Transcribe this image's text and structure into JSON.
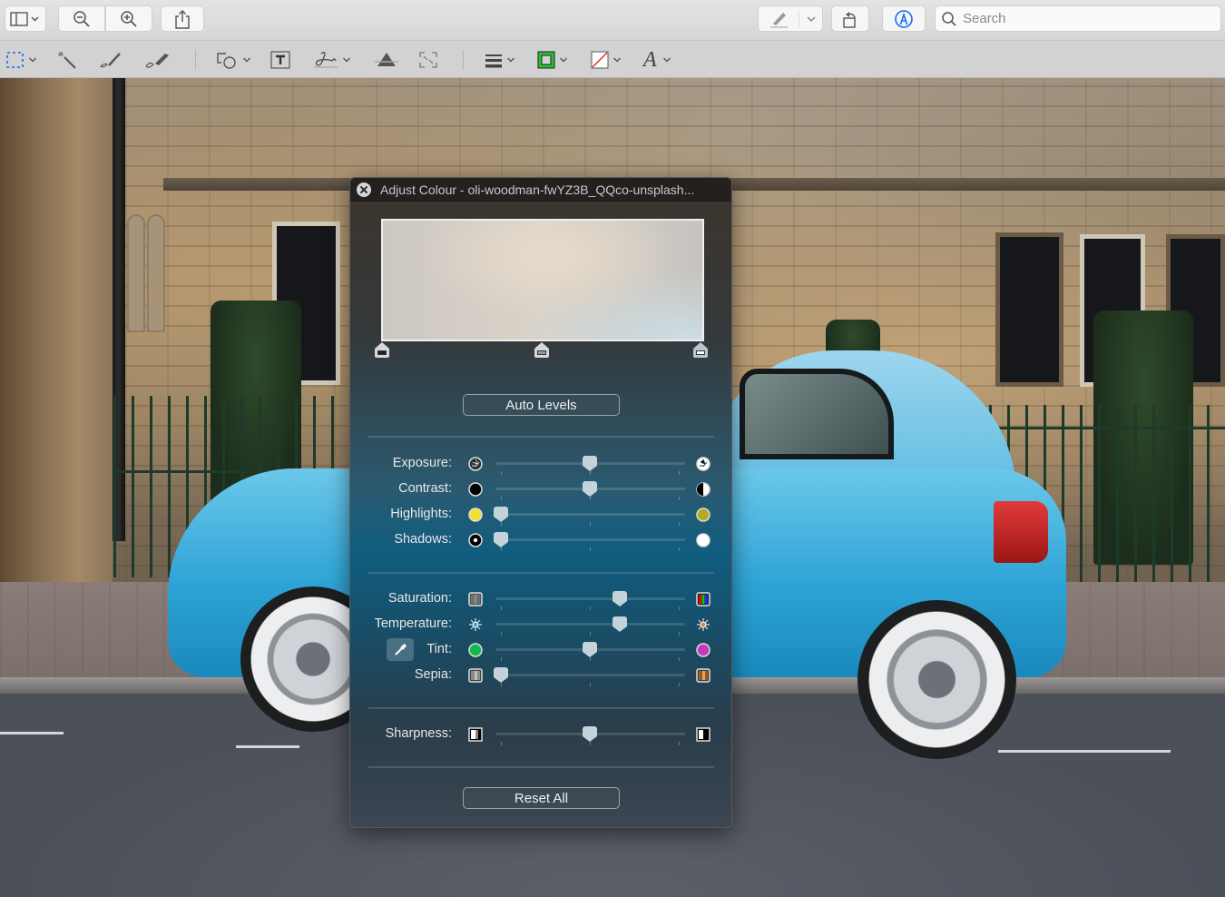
{
  "toolbar": {
    "sidebar_icon": "sidebar-icon",
    "zoom_out_icon": "zoom-out-icon",
    "zoom_in_icon": "zoom-in-icon",
    "share_icon": "share-icon",
    "highlight_icon": "highlighter-icon",
    "rotate_icon": "rotate-icon",
    "markup_icon": "markup-icon",
    "search_placeholder": "Search"
  },
  "markup": {
    "tools": [
      "selection",
      "instant-alpha",
      "sketch",
      "draw",
      "shapes",
      "text",
      "sign",
      "adjust-colour",
      "adjust-size",
      "shape-style",
      "border-colour",
      "fill-colour",
      "text-style"
    ],
    "border_colour": "#25c22a",
    "fill_colour": "none"
  },
  "panel": {
    "title": "Adjust Colour - oli-woodman-fwYZ3B_QQco-unsplash...",
    "levels": {
      "black": 0.0,
      "mid": 0.5,
      "white": 1.0
    },
    "auto_levels_label": "Auto Levels",
    "reset_all_label": "Reset All",
    "sliders": [
      {
        "label": "Exposure:",
        "value": 0.5,
        "left_icon": "exposure-low-icon",
        "right_icon": "exposure-high-icon"
      },
      {
        "label": "Contrast:",
        "value": 0.5,
        "left_icon": "contrast-low-icon",
        "right_icon": "contrast-high-icon"
      },
      {
        "label": "Highlights:",
        "value": 0.0,
        "left_icon": "highlights-low-icon",
        "right_icon": "highlights-high-icon"
      },
      {
        "label": "Shadows:",
        "value": 0.0,
        "left_icon": "shadows-low-icon",
        "right_icon": "shadows-high-icon"
      },
      {
        "label": "Saturation:",
        "value": 0.67,
        "left_icon": "saturation-low-icon",
        "right_icon": "saturation-high-icon"
      },
      {
        "label": "Temperature:",
        "value": 0.67,
        "left_icon": "temperature-cool-icon",
        "right_icon": "temperature-warm-icon"
      },
      {
        "label": "Tint:",
        "value": 0.5,
        "left_icon": "tint-green-icon",
        "right_icon": "tint-magenta-icon"
      },
      {
        "label": "Sepia:",
        "value": 0.0,
        "left_icon": "sepia-low-icon",
        "right_icon": "sepia-high-icon"
      },
      {
        "label": "Sharpness:",
        "value": 0.5,
        "left_icon": "sharpness-low-icon",
        "right_icon": "sharpness-high-icon"
      }
    ]
  }
}
